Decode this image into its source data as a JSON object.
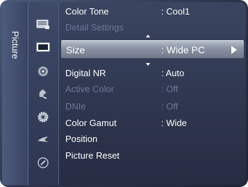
{
  "side_tab": {
    "label": "Picture"
  },
  "icons": [
    "picture-mode-icon",
    "picture-icon",
    "sound-icon",
    "channel-icon",
    "setup-icon",
    "input-icon",
    "support-icon"
  ],
  "menu": {
    "rows": [
      {
        "label": "Color Tone",
        "value": ": Cool1",
        "enabled": true
      },
      {
        "label": "Detail Settings",
        "value": "",
        "enabled": false
      },
      {
        "label": "Size",
        "value": ": Wide PC",
        "enabled": true,
        "selected": true
      },
      {
        "label": "Digital NR",
        "value": ": Auto",
        "enabled": true
      },
      {
        "label": "Active Color",
        "value": ": Off",
        "enabled": false
      },
      {
        "label": "DNIe",
        "value": ": Off",
        "enabled": false
      },
      {
        "label": "Color Gamut",
        "value": ": Wide",
        "enabled": true
      },
      {
        "label": "Position",
        "value": "",
        "enabled": true
      },
      {
        "label": "Picture Reset",
        "value": "",
        "enabled": true
      }
    ]
  },
  "colors": {
    "background": "#2a3148",
    "highlight": "#9aa2b0",
    "text": "#ffffff",
    "disabled_text": "#6c7896"
  }
}
